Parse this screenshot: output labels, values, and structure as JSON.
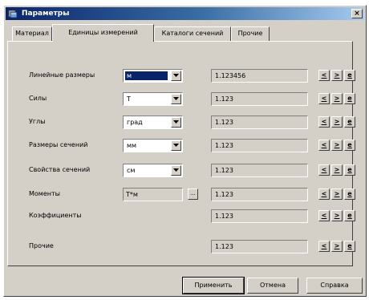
{
  "window": {
    "title": "Параметры",
    "close_glyph": "×"
  },
  "tabs": [
    {
      "label": "Материал",
      "active": false
    },
    {
      "label": "Единицы измерений",
      "active": true
    },
    {
      "label": "Каталоги сечений",
      "active": false
    },
    {
      "label": "Прочие",
      "active": false
    }
  ],
  "rows": [
    {
      "label": "Линейные размеры",
      "unit": "м",
      "unit_selected": true,
      "value": "1.123456"
    },
    {
      "label": "Силы",
      "unit": "Т",
      "value": "1.123"
    },
    {
      "label": "Углы",
      "unit": "град",
      "value": "1.123"
    },
    {
      "label": "Размеры сечений",
      "unit": "мм",
      "value": "1.123"
    },
    {
      "label": "Свойства сечений",
      "unit": "см",
      "value": "1.123"
    },
    {
      "label": "Моменты",
      "unit": "Т*м",
      "unit_readonly": true,
      "more_button": "...",
      "value": "1.123"
    },
    {
      "label": "Коэффициенты",
      "value": "1.123"
    },
    {
      "label": "Прочие",
      "value": "1.123"
    }
  ],
  "step_buttons": {
    "decrease": "<",
    "increase": ">",
    "exp": "e"
  },
  "footer": {
    "apply": "Применить",
    "cancel": "Отмена",
    "help": "Справка"
  }
}
